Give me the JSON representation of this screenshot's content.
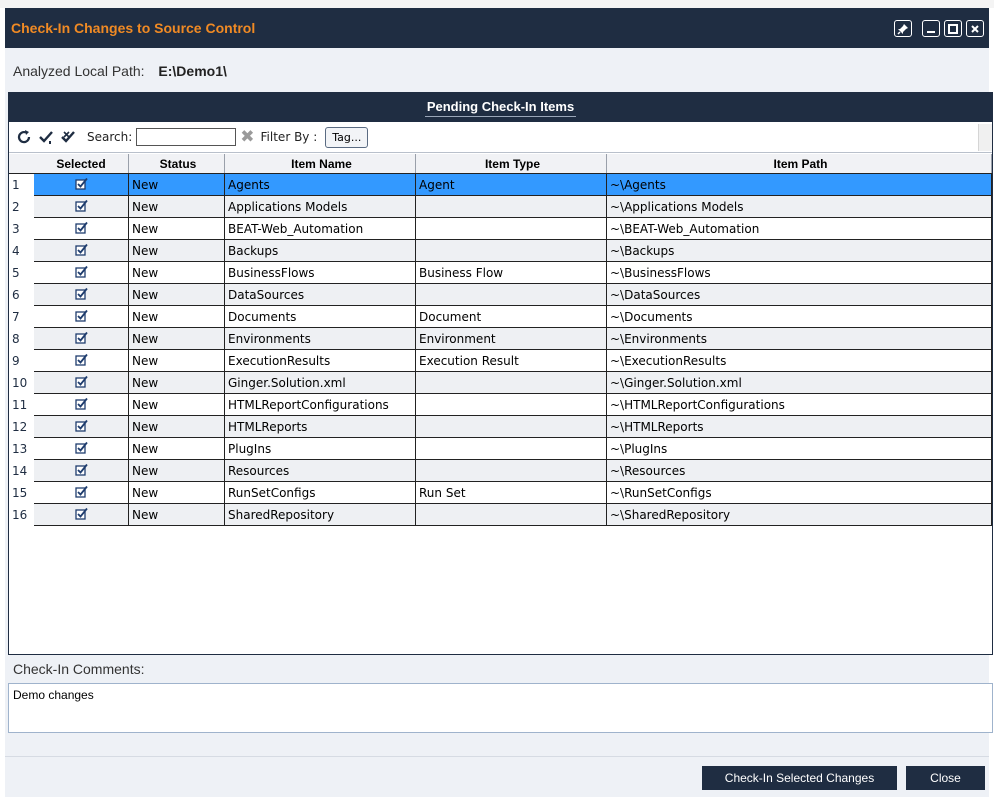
{
  "window": {
    "title": "Check-In Changes to Source Control",
    "pin_icon": "pin-icon",
    "minimize_icon": "minimize-icon",
    "maximize_icon": "maximize-icon",
    "close_icon": "close-icon"
  },
  "analyzed_path": {
    "label": "Analyzed Local Path:",
    "value": "E:\\Demo1\\"
  },
  "pending": {
    "header": "Pending Check-In Items",
    "toolbar": {
      "refresh_icon": "refresh-icon",
      "check_all_icon": "check-all-icon",
      "uncheck_all_icon": "uncheck-all-icon",
      "search_label": "Search:",
      "search_value": "",
      "filter_label": "Filter By :",
      "tag_button": "Tag..."
    },
    "columns": [
      "Selected",
      "Status",
      "Item Name",
      "Item Type",
      "Item Path"
    ],
    "rows": [
      {
        "num": "1",
        "status": "New",
        "name": "Agents",
        "type": "Agent",
        "path": "~\\Agents"
      },
      {
        "num": "2",
        "status": "New",
        "name": "Applications Models",
        "type": "",
        "path": "~\\Applications Models"
      },
      {
        "num": "3",
        "status": "New",
        "name": "BEAT-Web_Automation",
        "type": "",
        "path": "~\\BEAT-Web_Automation"
      },
      {
        "num": "4",
        "status": "New",
        "name": "Backups",
        "type": "",
        "path": "~\\Backups"
      },
      {
        "num": "5",
        "status": "New",
        "name": "BusinessFlows",
        "type": "Business Flow",
        "path": "~\\BusinessFlows"
      },
      {
        "num": "6",
        "status": "New",
        "name": "DataSources",
        "type": "",
        "path": "~\\DataSources"
      },
      {
        "num": "7",
        "status": "New",
        "name": "Documents",
        "type": "Document",
        "path": "~\\Documents"
      },
      {
        "num": "8",
        "status": "New",
        "name": "Environments",
        "type": "Environment",
        "path": "~\\Environments"
      },
      {
        "num": "9",
        "status": "New",
        "name": "ExecutionResults",
        "type": "Execution Result",
        "path": "~\\ExecutionResults"
      },
      {
        "num": "10",
        "status": "New",
        "name": "Ginger.Solution.xml",
        "type": "",
        "path": "~\\Ginger.Solution.xml"
      },
      {
        "num": "11",
        "status": "New",
        "name": "HTMLReportConfigurations",
        "type": "",
        "path": "~\\HTMLReportConfigurations"
      },
      {
        "num": "12",
        "status": "New",
        "name": "HTMLReports",
        "type": "",
        "path": "~\\HTMLReports"
      },
      {
        "num": "13",
        "status": "New",
        "name": "PlugIns",
        "type": "",
        "path": "~\\PlugIns"
      },
      {
        "num": "14",
        "status": "New",
        "name": "Resources",
        "type": "",
        "path": "~\\Resources"
      },
      {
        "num": "15",
        "status": "New",
        "name": "RunSetConfigs",
        "type": "Run Set",
        "path": "~\\RunSetConfigs"
      },
      {
        "num": "16",
        "status": "New",
        "name": "SharedRepository",
        "type": "",
        "path": "~\\SharedRepository"
      }
    ]
  },
  "comments": {
    "label": "Check-In Comments:",
    "value": "Demo changes"
  },
  "buttons": {
    "checkin": "Check-In Selected Changes",
    "close": "Close"
  }
}
